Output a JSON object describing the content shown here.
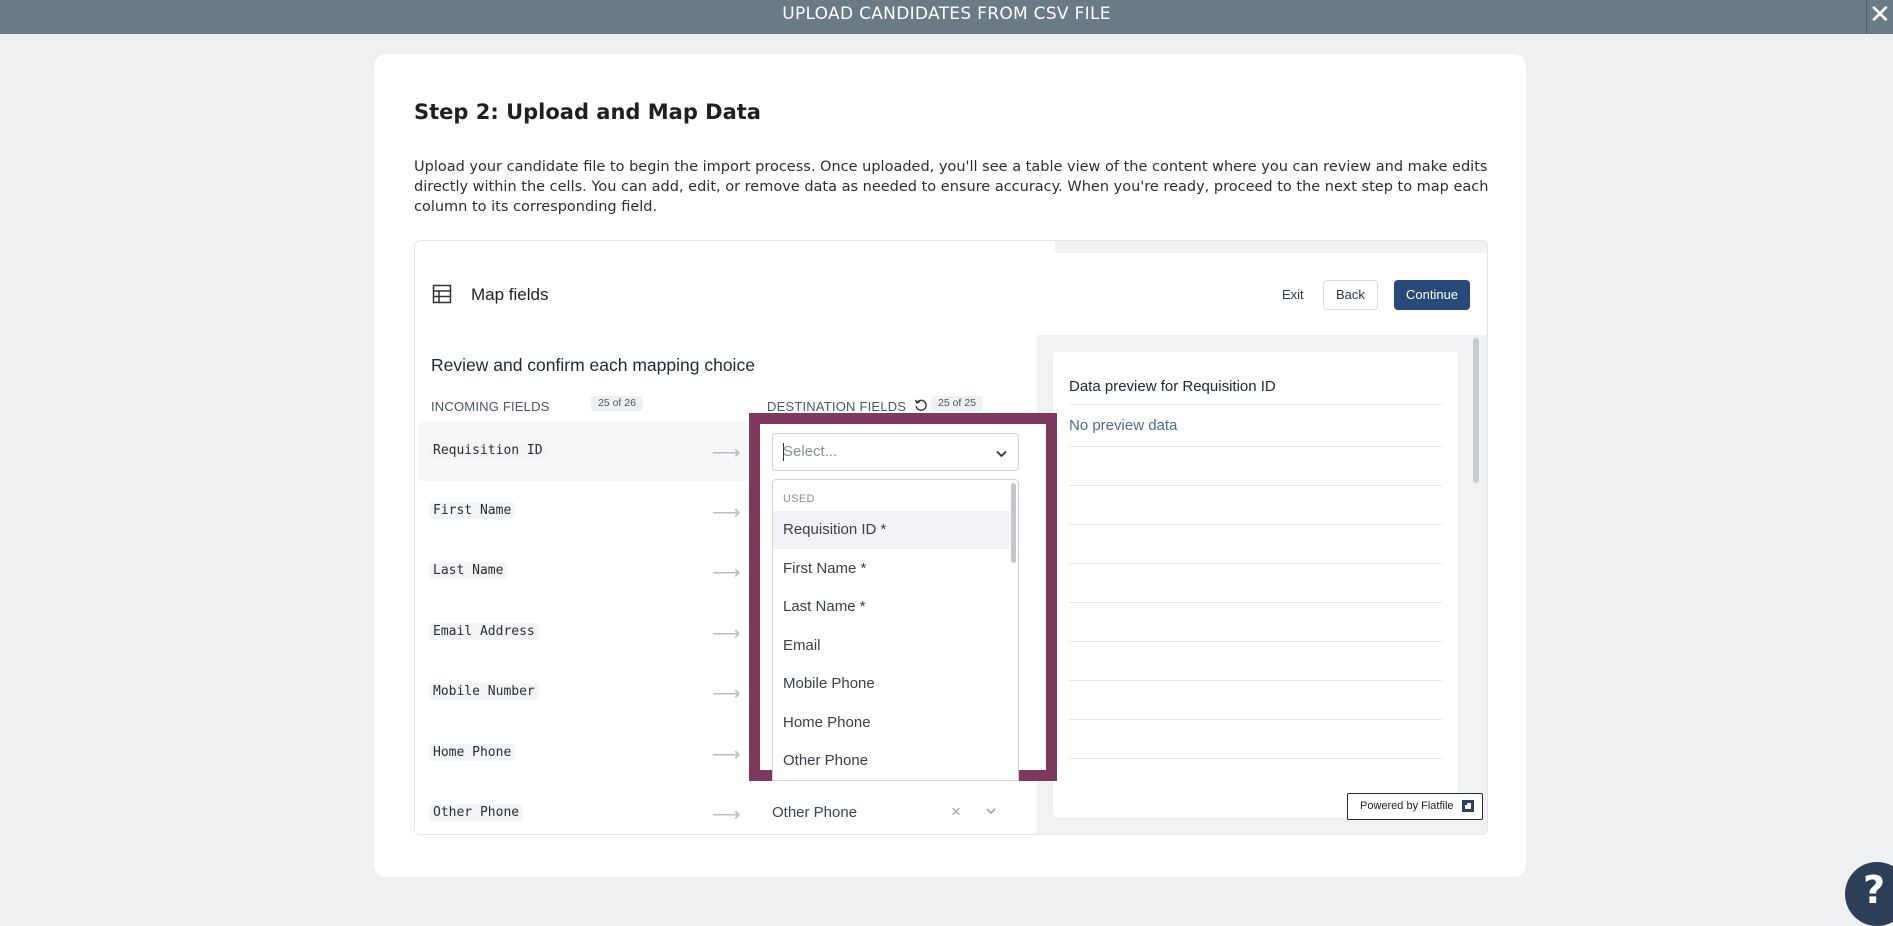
{
  "modal": {
    "title": "UPLOAD CANDIDATES FROM CSV FILE",
    "close_label": "✕"
  },
  "step": {
    "title": "Step 2: Upload and Map Data",
    "description": "Upload your candidate file to begin the import process. Once uploaded, you'll see a table view of the content where you can review and make edits directly within the cells. You can add, edit, or remove data as needed to ensure accuracy. When you're ready, proceed to the next step to map each column to its corresponding field."
  },
  "map_fields": {
    "title": "Map fields",
    "exit_label": "Exit",
    "back_label": "Back",
    "continue_label": "Continue",
    "review_title": "Review and confirm each mapping choice",
    "incoming_header": "INCOMING FIELDS",
    "incoming_count": "25 of 26",
    "destination_header": "DESTINATION FIELDS",
    "destination_count": "25 of 25",
    "rows": [
      {
        "source": "Requisition ID",
        "destination": ""
      },
      {
        "source": "First Name",
        "destination": ""
      },
      {
        "source": "Last Name",
        "destination": ""
      },
      {
        "source": "Email Address",
        "destination": ""
      },
      {
        "source": "Mobile Number",
        "destination": ""
      },
      {
        "source": "Home Phone",
        "destination": ""
      },
      {
        "source": "Other Phone",
        "destination": "Other Phone"
      }
    ]
  },
  "select": {
    "placeholder": "Select...",
    "section_label": "USED",
    "options": [
      "Requisition ID *",
      "First Name *",
      "Last Name *",
      "Email",
      "Mobile Phone",
      "Home Phone",
      "Other Phone"
    ]
  },
  "preview": {
    "title": "Data preview for Requisition ID",
    "empty_text": "No preview data"
  },
  "powered_by": "Powered by Flatfile",
  "help_label": "?",
  "colors": {
    "topbar": "#6a7b86",
    "highlight": "#7d3a5e",
    "primary_button": "#274a78"
  },
  "icons": [
    "close-icon",
    "table-icon",
    "reset-icon",
    "arrow-right-icon",
    "chevron-down-icon",
    "clear-icon",
    "flatfile-logo-icon",
    "help-icon"
  ]
}
